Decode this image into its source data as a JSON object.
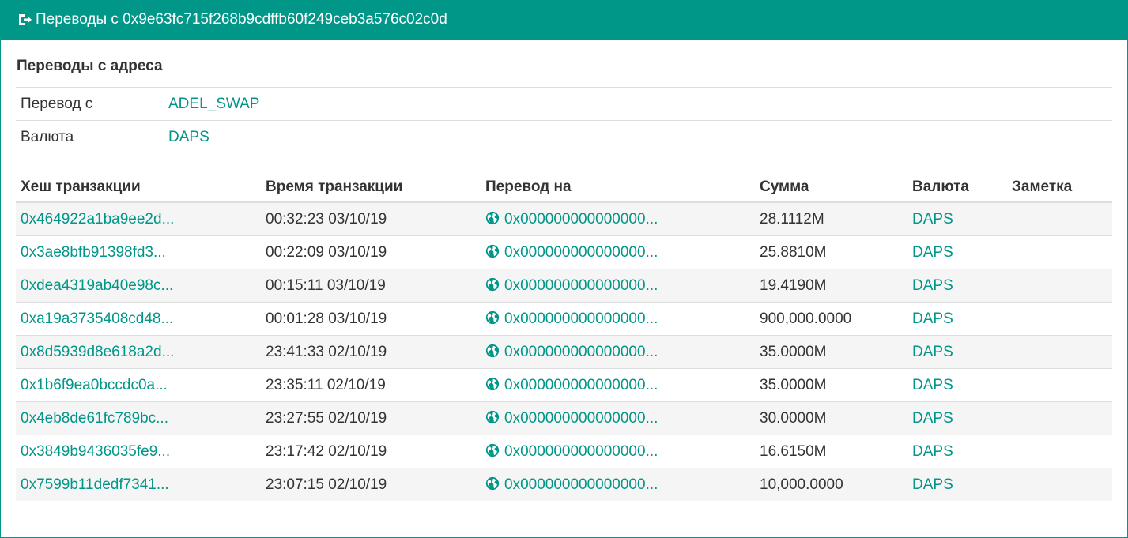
{
  "header": {
    "icon": "sign-out-icon",
    "title": "Переводы с 0x9e63fc715f268b9cdffb60f249ceb3a576c02c0d"
  },
  "section": {
    "title": "Переводы с адреса"
  },
  "info": [
    {
      "label": "Перевод с",
      "value": "ADEL_SWAP"
    },
    {
      "label": "Валюта",
      "value": "DAPS"
    }
  ],
  "table": {
    "columns": [
      "Хеш транзакции",
      "Время транзакции",
      "Перевод на",
      "Сумма",
      "Валюта",
      "Заметка"
    ],
    "rows": [
      {
        "hash": "0x464922a1ba9ee2d...",
        "time": "00:32:23 03/10/19",
        "to": "0x000000000000000...",
        "amount": "28.1112M",
        "currency": "DAPS",
        "note": ""
      },
      {
        "hash": "0x3ae8bfb91398fd3...",
        "time": "00:22:09 03/10/19",
        "to": "0x000000000000000...",
        "amount": "25.8810M",
        "currency": "DAPS",
        "note": ""
      },
      {
        "hash": "0xdea4319ab40e98c...",
        "time": "00:15:11 03/10/19",
        "to": "0x000000000000000...",
        "amount": "19.4190M",
        "currency": "DAPS",
        "note": ""
      },
      {
        "hash": "0xa19a3735408cd48...",
        "time": "00:01:28 03/10/19",
        "to": "0x000000000000000...",
        "amount": "900,000.0000",
        "currency": "DAPS",
        "note": ""
      },
      {
        "hash": "0x8d5939d8e618a2d...",
        "time": "23:41:33 02/10/19",
        "to": "0x000000000000000...",
        "amount": "35.0000M",
        "currency": "DAPS",
        "note": ""
      },
      {
        "hash": "0x1b6f9ea0bccdc0a...",
        "time": "23:35:11 02/10/19",
        "to": "0x000000000000000...",
        "amount": "35.0000M",
        "currency": "DAPS",
        "note": ""
      },
      {
        "hash": "0x4eb8de61fc789bc...",
        "time": "23:27:55 02/10/19",
        "to": "0x000000000000000...",
        "amount": "30.0000M",
        "currency": "DAPS",
        "note": ""
      },
      {
        "hash": "0x3849b9436035fe9...",
        "time": "23:17:42 02/10/19",
        "to": "0x000000000000000...",
        "amount": "16.6150M",
        "currency": "DAPS",
        "note": ""
      },
      {
        "hash": "0x7599b11dedf7341...",
        "time": "23:07:15 02/10/19",
        "to": "0x000000000000000...",
        "amount": "10,000.0000",
        "currency": "DAPS",
        "note": ""
      }
    ],
    "to_icon": "globe-icon"
  },
  "colors": {
    "accent": "#009688",
    "header_text": "#ffffff",
    "stripe": "#f5f5f5"
  }
}
